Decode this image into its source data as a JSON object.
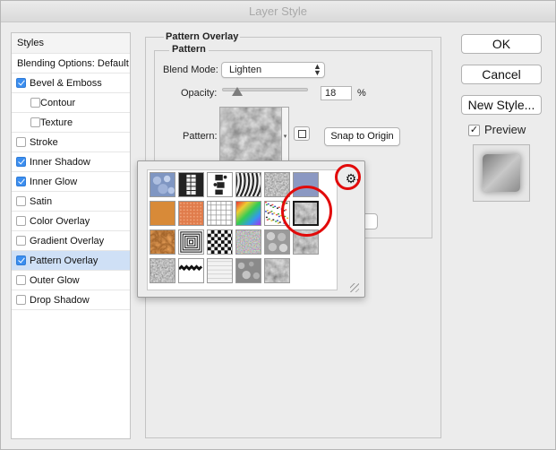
{
  "window": {
    "title": "Layer Style"
  },
  "styles_list": {
    "header": "Styles",
    "blending": "Blending Options: Default",
    "items": [
      {
        "label": "Bevel & Emboss",
        "checked": true,
        "indent": false,
        "selected": false
      },
      {
        "label": "Contour",
        "checked": false,
        "indent": true,
        "selected": false
      },
      {
        "label": "Texture",
        "checked": false,
        "indent": true,
        "selected": false
      },
      {
        "label": "Stroke",
        "checked": false,
        "indent": false,
        "selected": false
      },
      {
        "label": "Inner Shadow",
        "checked": true,
        "indent": false,
        "selected": false
      },
      {
        "label": "Inner Glow",
        "checked": true,
        "indent": false,
        "selected": false
      },
      {
        "label": "Satin",
        "checked": false,
        "indent": false,
        "selected": false
      },
      {
        "label": "Color Overlay",
        "checked": false,
        "indent": false,
        "selected": false
      },
      {
        "label": "Gradient Overlay",
        "checked": false,
        "indent": false,
        "selected": false
      },
      {
        "label": "Pattern Overlay",
        "checked": true,
        "indent": false,
        "selected": true
      },
      {
        "label": "Outer Glow",
        "checked": false,
        "indent": false,
        "selected": false
      },
      {
        "label": "Drop Shadow",
        "checked": false,
        "indent": false,
        "selected": false
      }
    ]
  },
  "panel": {
    "group_title": "Pattern Overlay",
    "sub_title": "Pattern",
    "blend_label": "Blend Mode:",
    "blend_value": "Lighten",
    "opacity_label": "Opacity:",
    "opacity_value": "18",
    "opacity_unit": "%",
    "opacity_fraction": 0.18,
    "pattern_label": "Pattern:",
    "snap_button": "Snap to Origin",
    "hidden_button_fragment": "t"
  },
  "buttons": {
    "ok": "OK",
    "cancel": "Cancel",
    "new_style": "New Style...",
    "preview_label": "Preview",
    "preview_checked": "✓"
  },
  "picker": {
    "gear_icon": "⚙",
    "gear_caret": "▾",
    "selected_row": 1,
    "selected_col": 5,
    "swatches": [
      [
        "blue-bubbles",
        "cobweb-bw",
        "puzzle-bw",
        "zebra-stripes",
        "gray-noise",
        "periwinkle"
      ],
      [
        "orange-solid",
        "orange-dots",
        "white-grid",
        "rainbow",
        "confetti",
        "gray-marble"
      ],
      [
        "rust-texture",
        "concentric-squares",
        "checker-bw",
        "color-noise",
        "gray-bubbles",
        "gray-crinkle"
      ],
      [
        "gray-gravel",
        "black-zigzag",
        "white-brick",
        "gray-spots",
        "gray-stones",
        ""
      ]
    ]
  },
  "colors": {
    "accent": "#3b8ef0",
    "highlight_ring": "#e20a0a",
    "selection": "#cfe0f6"
  }
}
